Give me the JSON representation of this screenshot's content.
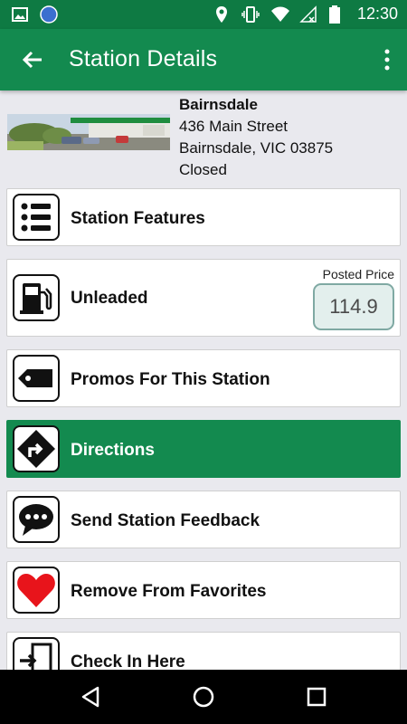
{
  "status_bar": {
    "time": "12:30"
  },
  "app_bar": {
    "title": "Station Details"
  },
  "station": {
    "name": "Bairnsdale",
    "address_line1": "436 Main Street",
    "address_line2": "Bairnsdale, VIC 03875",
    "status": "Closed"
  },
  "rows": {
    "features": {
      "label": "Station Features",
      "icon": "list-icon"
    },
    "fuel": {
      "label": "Unleaded",
      "icon": "fuel-pump-icon",
      "posted_price_label": "Posted Price",
      "price": "114.9"
    },
    "promos": {
      "label": "Promos For This Station",
      "icon": "tag-icon"
    },
    "directions": {
      "label": "Directions",
      "icon": "directions-icon"
    },
    "feedback": {
      "label": "Send Station Feedback",
      "icon": "chat-bubble-icon"
    },
    "favorites": {
      "label": "Remove From Favorites",
      "icon": "heart-icon"
    },
    "checkin": {
      "label": "Check In Here",
      "icon": "check-in-door-icon"
    }
  },
  "colors": {
    "primary": "#138a4f",
    "status_bar": "#0e7a43",
    "favorite_red": "#e8141b",
    "price_border": "#7fa9a3"
  }
}
